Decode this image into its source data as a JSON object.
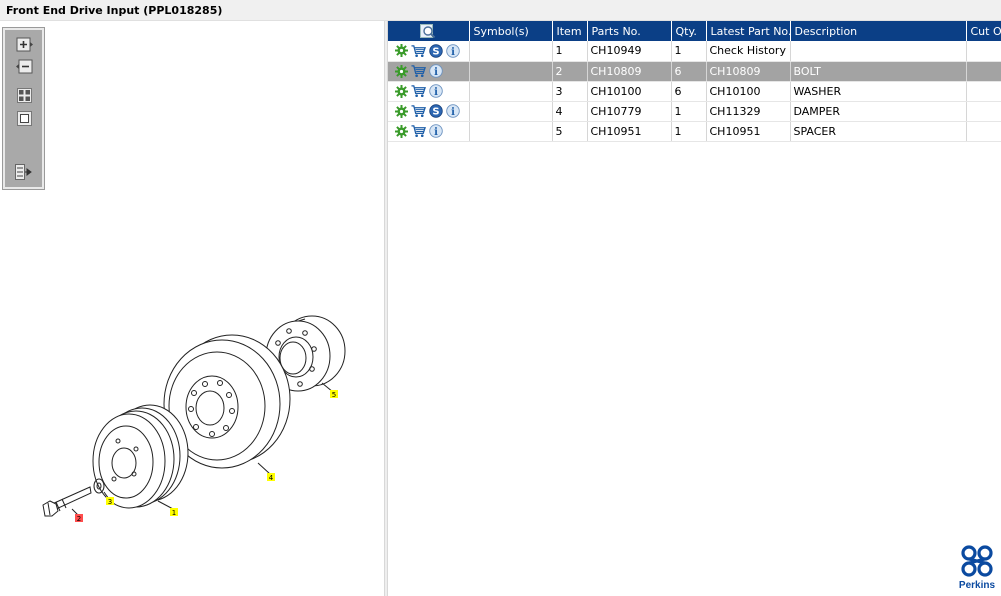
{
  "window": {
    "title": "Front End Drive Input (PPL018285)"
  },
  "toolbar": {
    "buttons": [
      "zoom-in",
      "zoom-out",
      "fit-all",
      "actual-size",
      "toggle-list"
    ]
  },
  "drawing": {
    "callouts": [
      {
        "label": "1",
        "color": "#ffff00"
      },
      {
        "label": "2",
        "color": "#ff4d4d"
      },
      {
        "label": "3",
        "color": "#ffff00"
      },
      {
        "label": "4",
        "color": "#ffff00"
      },
      {
        "label": "5",
        "color": "#ffff00"
      }
    ]
  },
  "table": {
    "headers": {
      "symbols": "Symbol(s)",
      "item": "Item",
      "parts_no": "Parts No.",
      "qty": "Qty.",
      "latest": "Latest Part No.",
      "description": "Description",
      "cut_off": "Cut O"
    },
    "rows": [
      {
        "item": "1",
        "parts_no": "CH10949",
        "qty": "1",
        "latest": "Check History",
        "description": "",
        "has_s": true
      },
      {
        "item": "2",
        "parts_no": "CH10809",
        "qty": "6",
        "latest": "CH10809",
        "description": "BOLT",
        "has_s": false
      },
      {
        "item": "3",
        "parts_no": "CH10100",
        "qty": "6",
        "latest": "CH10100",
        "description": "WASHER",
        "has_s": false
      },
      {
        "item": "4",
        "parts_no": "CH10779",
        "qty": "1",
        "latest": "CH11329",
        "description": "DAMPER",
        "has_s": true
      },
      {
        "item": "5",
        "parts_no": "CH10951",
        "qty": "1",
        "latest": "CH10951",
        "description": "SPACER",
        "has_s": false
      }
    ],
    "selected_row": 1
  },
  "icons": {
    "s_letter": "S",
    "i_letter": "i"
  },
  "colors": {
    "header_bg": "#0b3f86",
    "selected_row": "#a3a3a3",
    "gear": "#3a9b2a",
    "cart": "#1f5fa8"
  },
  "logo": {
    "text": "Perkins"
  }
}
